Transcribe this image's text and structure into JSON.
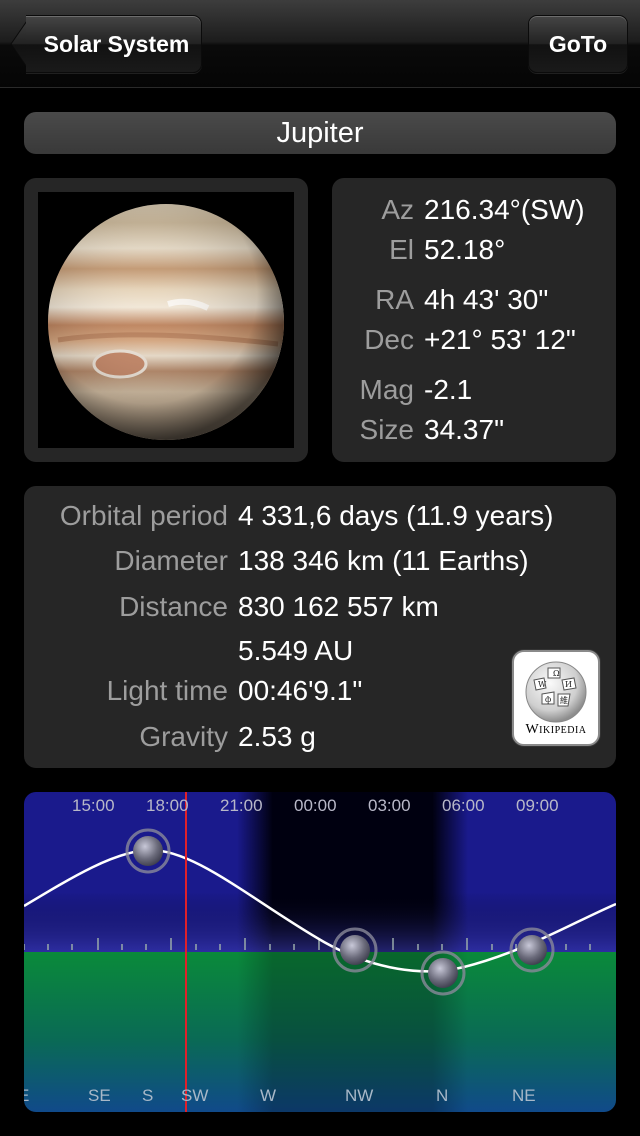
{
  "navbar": {
    "back_label": "Solar System",
    "goto_label": "GoTo"
  },
  "object": {
    "name": "Jupiter"
  },
  "coords": [
    {
      "label": "Az",
      "value": "216.34°(SW)"
    },
    {
      "label": "El",
      "value": "52.18°"
    },
    {
      "label": "RA",
      "value": "4h 43' 30\""
    },
    {
      "label": "Dec",
      "value": "+21° 53' 12\""
    },
    {
      "label": "Mag",
      "value": "-2.1"
    },
    {
      "label": "Size",
      "value": "34.37\""
    }
  ],
  "info": {
    "orbital_period_label": "Orbital period",
    "orbital_period_value": "4 331,6 days (11.9 years)",
    "diameter_label": "Diameter",
    "diameter_value": "138 346 km (11 Earths)",
    "distance_label": "Distance",
    "distance_km": "830 162 557 km",
    "distance_au": "5.549 AU",
    "light_time_label": "Light time",
    "light_time_value": "00:46'9.1\"",
    "gravity_label": "Gravity",
    "gravity_value": "2.53 g"
  },
  "wikipedia": {
    "label": "Wikipedia",
    "icon": "wikipedia-globe-icon"
  },
  "chart": {
    "time_labels": [
      "15:00",
      "18:00",
      "21:00",
      "00:00",
      "03:00",
      "06:00",
      "09:00"
    ],
    "direction_labels": [
      "E",
      "SE",
      "S",
      "SW",
      "W",
      "NW",
      "N",
      "NE"
    ],
    "colors": {
      "sky_day": "#1a1a8c",
      "ground": "#0a8a3a",
      "now_line": "#e0202a",
      "path": "#ffffff"
    }
  }
}
